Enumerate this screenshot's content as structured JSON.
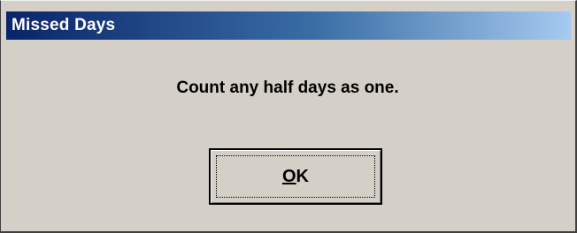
{
  "window": {
    "title": "Missed Days"
  },
  "dialog": {
    "message": "Count any half days as one."
  },
  "buttons": {
    "ok": {
      "mnemonic": "O",
      "rest": "K"
    }
  }
}
